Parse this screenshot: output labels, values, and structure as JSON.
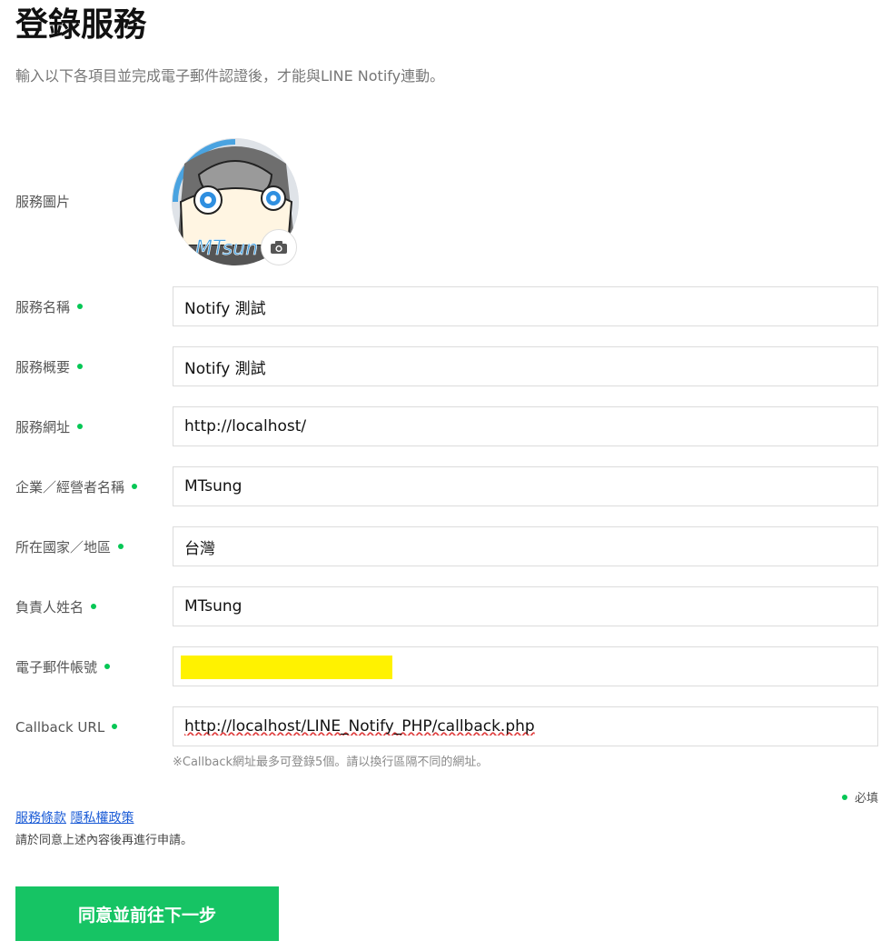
{
  "page": {
    "title": "登錄服務",
    "subtitle": "輸入以下各項目並完成電子郵件認證後，才能與LINE Notify連動。"
  },
  "form": {
    "image_label": "服務圖片",
    "fields": [
      {
        "label": "服務名稱",
        "value": "Notify 測試"
      },
      {
        "label": "服務概要",
        "value": "Notify 測試"
      },
      {
        "label": "服務網址",
        "value": "http://localhost/"
      },
      {
        "label": "企業／經營者名稱",
        "value": "MTsung"
      },
      {
        "label": "所在國家／地區",
        "value": "台灣"
      },
      {
        "label": "負責人姓名",
        "value": "MTsung"
      },
      {
        "label": "電子郵件帳號",
        "value": ""
      },
      {
        "label": "Callback URL",
        "value": "http://localhost/LINE_Notify_PHP/callback.php"
      }
    ],
    "callback_hint": "※Callback網址最多可登錄5個。請以換行區隔不同的網址。",
    "required_note": "必填"
  },
  "links": {
    "terms": "服務條款",
    "privacy": "隱私權政策"
  },
  "agreement_text": "請於同意上述內容後再進行申請。",
  "submit_label": "同意並前往下一步",
  "colors": {
    "accent": "#06c755",
    "button": "#16c464",
    "link": "#1a5bd6",
    "redaction": "#fff200"
  },
  "icons": {
    "camera": "camera-icon",
    "required": "required-dot"
  }
}
